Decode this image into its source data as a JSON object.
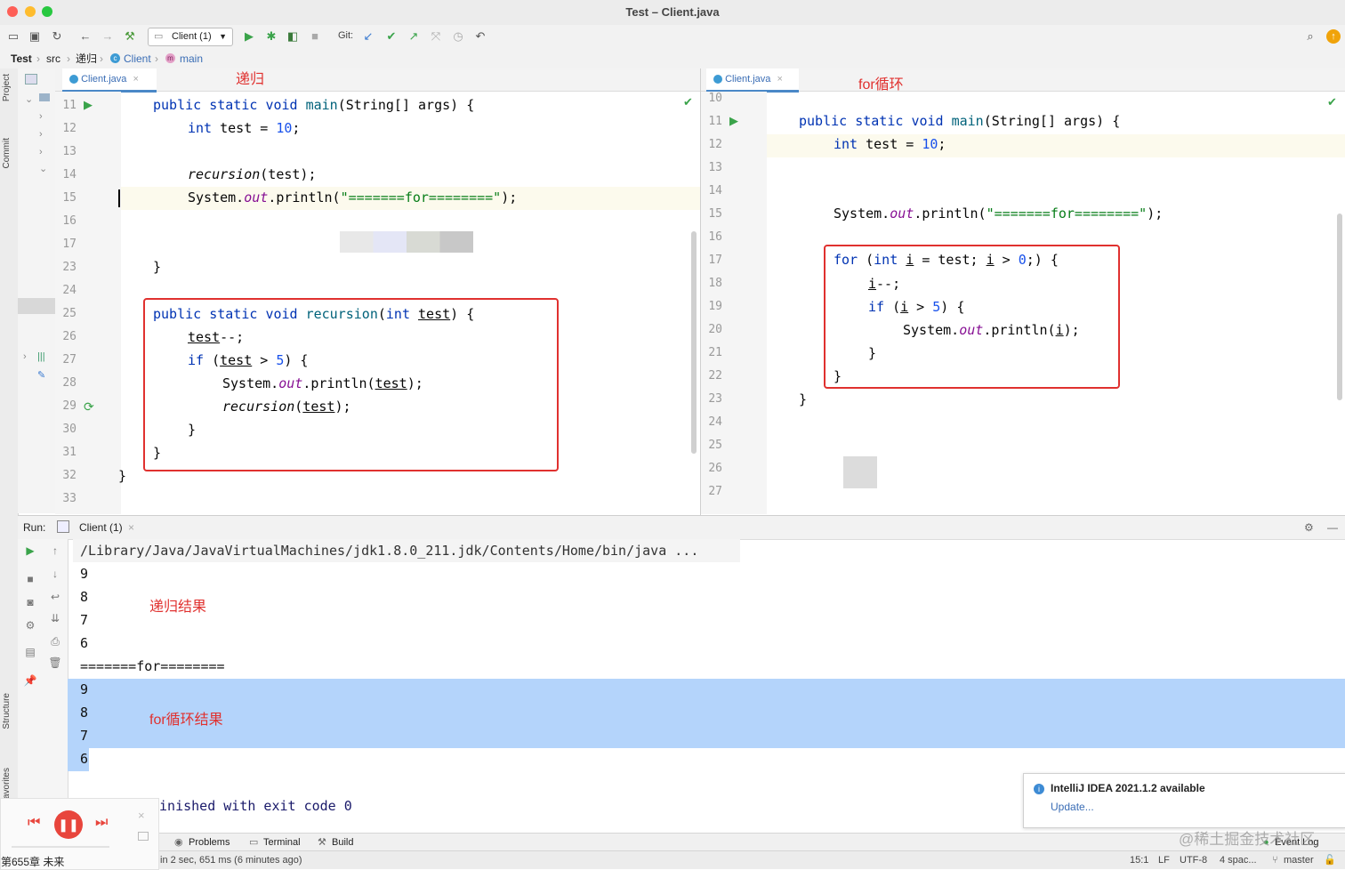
{
  "window": {
    "title": "Test – Client.java",
    "colors": {
      "close": "#fe5f57",
      "minimize": "#febc2e",
      "maximize": "#28c840"
    }
  },
  "toolbar": {
    "run_config": "Client (1)",
    "git_label": "Git:"
  },
  "breadcrumb": [
    "Test",
    "src",
    "递归",
    "Client",
    "main"
  ],
  "left_strip": {
    "project": "Project",
    "commit": "Commit",
    "structure": "Structure",
    "favorites": "Favorites"
  },
  "left_editor": {
    "tab": "Client.java",
    "annotation": "递归",
    "line_numbers": [
      "11",
      "12",
      "13",
      "14",
      "15",
      "16",
      "17",
      "23",
      "24",
      "25",
      "26",
      "27",
      "28",
      "29",
      "30",
      "31",
      "32",
      "33"
    ]
  },
  "right_editor": {
    "tab": "Client.java",
    "annotation": "for循环",
    "line_numbers": [
      "10",
      "11",
      "12",
      "13",
      "14",
      "15",
      "16",
      "17",
      "18",
      "19",
      "20",
      "21",
      "22",
      "23",
      "24",
      "25",
      "26",
      "27"
    ]
  },
  "code": {
    "public": "public",
    "static": "static",
    "void": "void",
    "main": "main",
    "main_args": "(String[] args) {",
    "int": "int",
    "test_decl": " test = ",
    "ten": "10",
    "semi": ";",
    "recursion": "recursion",
    "recursion_call_args": "(test);",
    "system": "System.",
    "out": "out",
    "println_open": ".println(",
    "for_string": "\"=======for========\"",
    "close_paren": ");",
    "close_brace": "}",
    "recursion_sig_open": "(",
    "test": "test",
    "sig_close": ") {",
    "decrement": "--;",
    "if": "if",
    "paren_open": "(",
    "gt": " > ",
    "five": "5",
    "println_test_open": ".println(",
    "for": "for",
    "i": "i",
    "for_mid": " = test; ",
    "zero": "0",
    "for_end": ";) {"
  },
  "run_panel": {
    "label": "Run:",
    "tab": "Client (1)",
    "command": "/Library/Java/JavaVirtualMachines/jdk1.8.0_211.jdk/Contents/Home/bin/java ...",
    "output": [
      "9",
      "8",
      "7",
      "6",
      "=======for========",
      "9",
      "8",
      "7",
      "6"
    ],
    "finished": "finished with exit code 0",
    "annotation_recursion": "递归结果",
    "annotation_for": "for循环结果"
  },
  "bottom_tabs": [
    "Problems",
    "Terminal",
    "Build"
  ],
  "event_log": "Event Log",
  "notification": {
    "title": "IntelliJ IDEA 2021.1.2 available",
    "link": "Update..."
  },
  "status": {
    "build_message": "in 2 sec, 651 ms (6 minutes ago)",
    "position": "15:1",
    "line_sep": "LF",
    "encoding": "UTF-8",
    "indent": "4 spac...",
    "branch": "master"
  },
  "player": {
    "track": "第655章 未来",
    "accent": "#e8453c"
  },
  "watermark": "@稀土掘金技术社区"
}
